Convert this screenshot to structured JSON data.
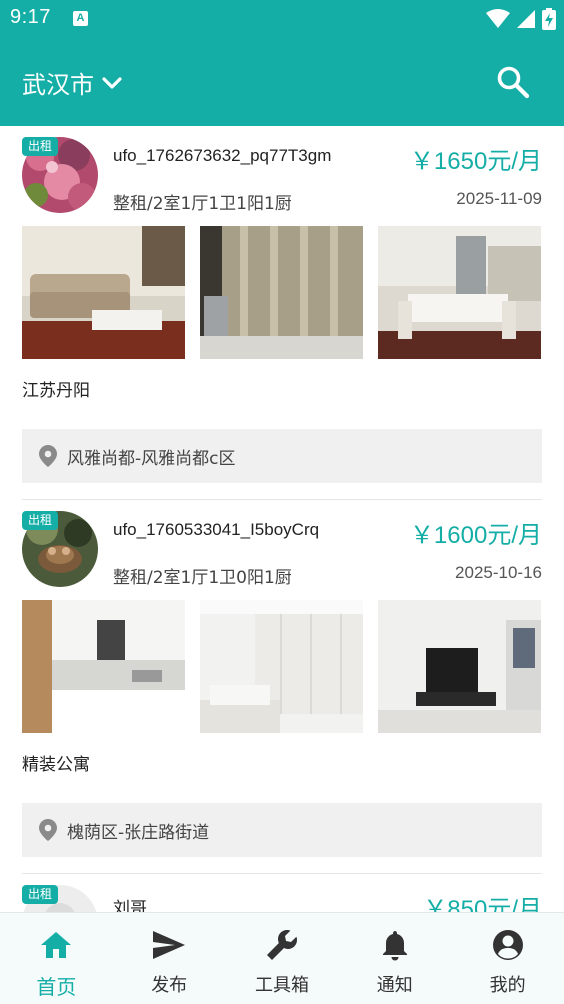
{
  "status_bar": {
    "time": "9:17",
    "notif_letter": "A"
  },
  "app_bar": {
    "city": "武汉市",
    "icons": {
      "dropdown": "chevron-down-icon",
      "search": "search-icon"
    }
  },
  "colors": {
    "accent": "#15aea6",
    "address_bg": "#f0f0f0"
  },
  "listings": [
    {
      "badge": "出租",
      "user": "ufo_1762673632_pq77T3gm",
      "price": "￥1650元/月",
      "layout": "整租/2室1厅1卫1阳1厨",
      "date": "2025-11-09",
      "title": "江苏丹阳",
      "address": "风雅尚都-风雅尚都c区"
    },
    {
      "badge": "出租",
      "user": "ufo_1760533041_I5boyCrq",
      "price": "￥1600元/月",
      "layout": "整租/2室1厅1卫0阳1厨",
      "date": "2025-10-16",
      "title": "精装公寓",
      "address": "槐荫区-张庄路街道"
    },
    {
      "badge": "出租",
      "user": "刘哥",
      "price": "￥850元/月"
    }
  ],
  "bottom_nav": [
    {
      "label": "首页",
      "icon": "home-icon",
      "active": true
    },
    {
      "label": "发布",
      "icon": "send-icon",
      "active": false
    },
    {
      "label": "工具箱",
      "icon": "wrench-icon",
      "active": false
    },
    {
      "label": "通知",
      "icon": "bell-icon",
      "active": false
    },
    {
      "label": "我的",
      "icon": "account-icon",
      "active": false
    }
  ]
}
